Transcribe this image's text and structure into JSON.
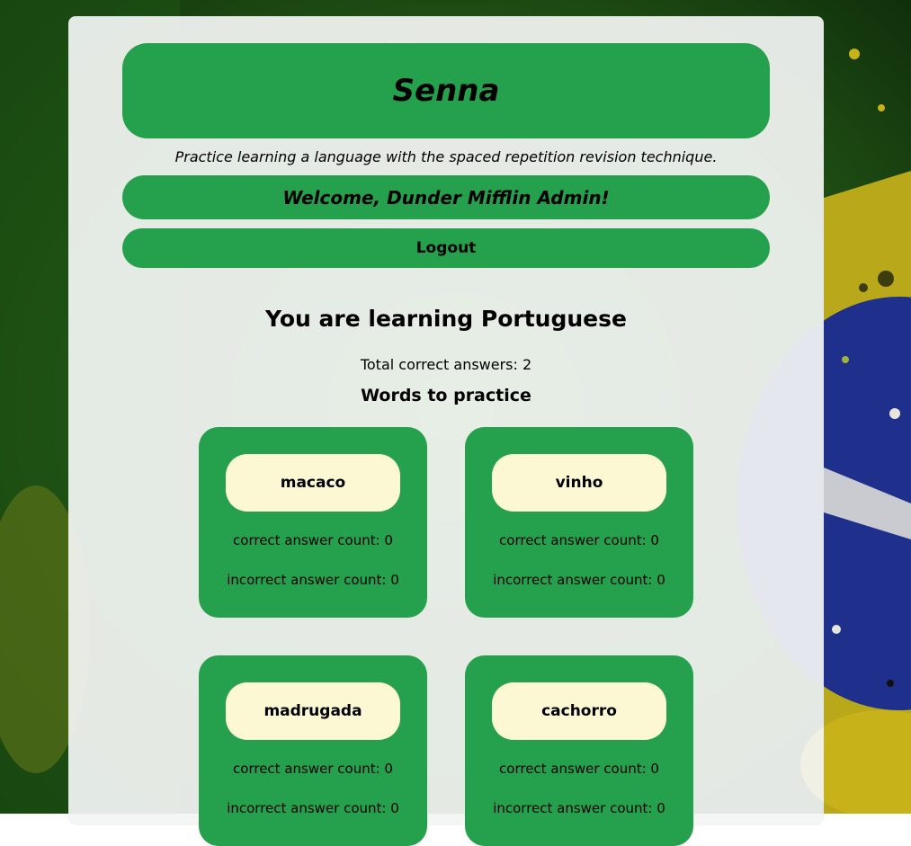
{
  "header": {
    "title": "Senna",
    "tagline": "Practice learning a language with the spaced repetition revision technique.",
    "welcome": "Welcome, Dunder Mifflin Admin!",
    "logout_label": "Logout"
  },
  "main": {
    "learning_heading": "You are learning Portuguese",
    "total_correct": "Total correct answers: 2",
    "practice_heading": "Words to practice",
    "words": [
      {
        "word": "macaco",
        "correct": "correct answer count: 0",
        "incorrect": "incorrect answer count: 0"
      },
      {
        "word": "vinho",
        "correct": "correct answer count: 0",
        "incorrect": "incorrect answer count: 0"
      },
      {
        "word": "madrugada",
        "correct": "correct answer count: 0",
        "incorrect": "incorrect answer count: 0"
      },
      {
        "word": "cachorro",
        "correct": "correct answer count: 0",
        "incorrect": "incorrect answer count: 0"
      }
    ]
  },
  "colors": {
    "accent_green": "#25a04c",
    "word_pill": "#fdf8d4",
    "panel": "#f3f5f4",
    "flag_blue": "#1e2f8c",
    "flag_yellow": "#d8c21a"
  }
}
